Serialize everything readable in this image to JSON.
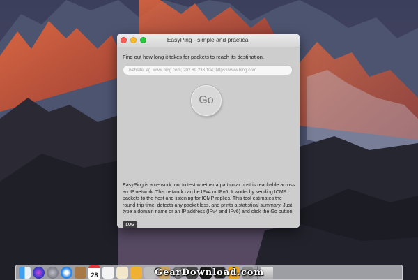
{
  "window": {
    "title": "EasyPing - simple and practical"
  },
  "main": {
    "instruction": "Find out how long it takes for packets to reach its destination.",
    "url_placeholder": "website: eg. www.bing.com; 202.89.233.104; https://www.bing.com",
    "url_value": "",
    "go_label": "Go",
    "description": "EasyPing is a network tool to test whether a particular host is reachable across an IP network. This network can be IPv4 or IPv6. It works by sending ICMP packets to the host and listening for ICMP replies. This tool estimates the round-trip time, detects any packet loss, and prints a statistical summary. Just type a domain name or an IP address (IPv4 and IPv6) and click the Go button.",
    "log_tab_label": "LOG"
  },
  "dock": {
    "calendar_day": "28",
    "watermark": "GearDownload.com",
    "items": [
      "finder-icon",
      "siri-icon",
      "launchpad-icon",
      "safari-icon",
      "notes-icon",
      "calendar-icon",
      "reminders-icon",
      "app-icon",
      "app-icon",
      "app-icon",
      "system-preferences-icon",
      "app-icon",
      "terminal-icon",
      "console-icon",
      "app-icon",
      "app-icon",
      "trash-icon"
    ]
  }
}
